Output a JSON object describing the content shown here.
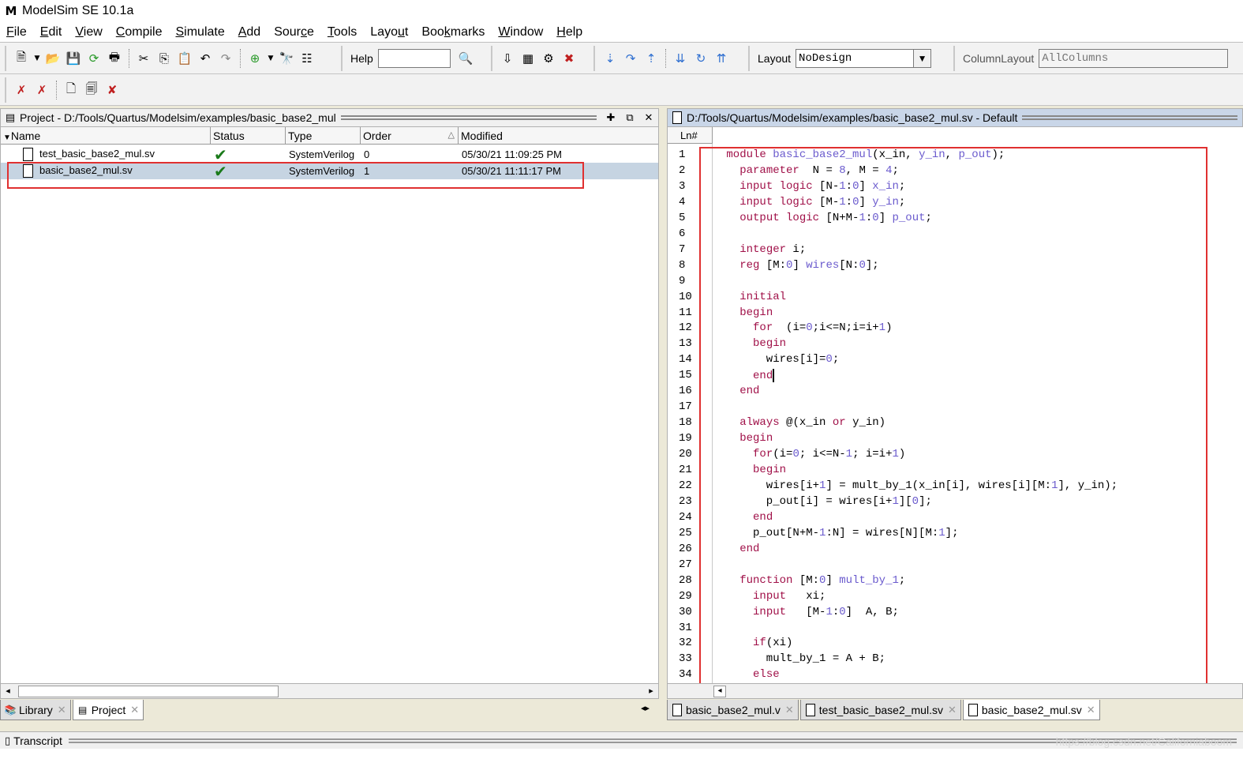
{
  "window": {
    "title": "ModelSim SE 10.1a",
    "logo_letter": "M"
  },
  "menubar": [
    {
      "pre": "",
      "ul": "F",
      "post": "ile"
    },
    {
      "pre": "",
      "ul": "E",
      "post": "dit"
    },
    {
      "pre": "",
      "ul": "V",
      "post": "iew"
    },
    {
      "pre": "",
      "ul": "C",
      "post": "ompile"
    },
    {
      "pre": "",
      "ul": "S",
      "post": "imulate"
    },
    {
      "pre": "",
      "ul": "A",
      "post": "dd"
    },
    {
      "pre": "Sour",
      "ul": "c",
      "post": "e"
    },
    {
      "pre": "",
      "ul": "T",
      "post": "ools"
    },
    {
      "pre": "Layo",
      "ul": "u",
      "post": "t"
    },
    {
      "pre": "Boo",
      "ul": "k",
      "post": "marks"
    },
    {
      "pre": "",
      "ul": "W",
      "post": "indow"
    },
    {
      "pre": "",
      "ul": "H",
      "post": "elp"
    }
  ],
  "toolbar": {
    "help_label": "Help",
    "help_value": "",
    "layout_label": "Layout",
    "layout_value": "NoDesign",
    "column_layout_label": "ColumnLayout",
    "column_layout_value": "AllColumns"
  },
  "project_pane": {
    "title": "Project - D:/Tools/Quartus/Modelsim/examples/basic_base2_mul",
    "columns": [
      "Name",
      "Status",
      "Type",
      "Order",
      "Modified"
    ],
    "rows": [
      {
        "name": "test_basic_base2_mul.sv",
        "status": "✔",
        "type": "SystemVerilog",
        "order": "0",
        "modified": "05/30/21 11:09:25 PM"
      },
      {
        "name": "basic_base2_mul.sv",
        "status": "✔",
        "type": "SystemVerilog",
        "order": "1",
        "modified": "05/30/21 11:11:17 PM"
      }
    ]
  },
  "left_tabs": [
    {
      "label": "Library"
    },
    {
      "label": "Project"
    }
  ],
  "source_pane": {
    "title": "D:/Tools/Quartus/Modelsim/examples/basic_base2_mul.sv - Default",
    "ln_header": "Ln#",
    "line_numbers": [
      "1",
      "2",
      "3",
      "4",
      "5",
      "6",
      "7",
      "8",
      "9",
      "10",
      "11",
      "12",
      "13",
      "14",
      "15",
      "16",
      "17",
      "18",
      "19",
      "20",
      "21",
      "22",
      "23",
      "24",
      "25",
      "26",
      "27",
      "28",
      "29",
      "30",
      "31",
      "32",
      "33",
      "34"
    ]
  },
  "source_tabs": [
    {
      "label": "basic_base2_mul.v"
    },
    {
      "label": "test_basic_base2_mul.sv"
    },
    {
      "label": "basic_base2_mul.sv"
    }
  ],
  "transcript": {
    "title": "Transcript",
    "watermark": "https://blog.csdn.net/Californiaboom"
  },
  "colors": {
    "keyword": "#a01048",
    "identifier": "#6a5acd",
    "highlight_box": "#e03030",
    "selection": "#c6d4e2"
  }
}
